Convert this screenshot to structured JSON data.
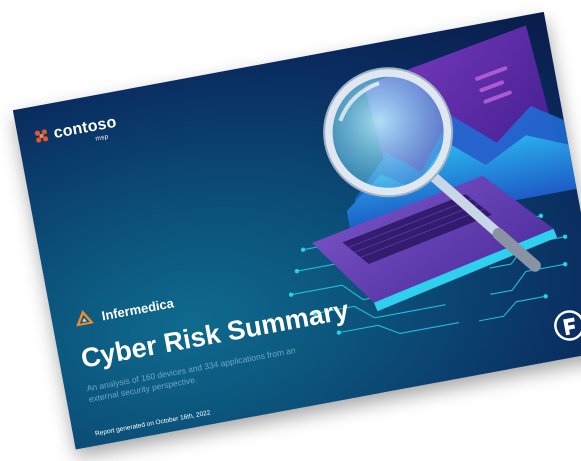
{
  "brand": {
    "name": "contoso",
    "sub": "msp"
  },
  "client": {
    "name": "Infermedica"
  },
  "report": {
    "title": "Cyber Risk Summary",
    "subtitle": "An analysis of 160 devices and 334 applications from an external security perspective.",
    "generated": "Report generated on October 16th, 2022"
  },
  "colors": {
    "brand_accent": "#e4572e",
    "client_accent": "#f28c28",
    "background": "#0b4f78",
    "art_purple": "#5b2ea6",
    "art_cyan": "#39d0f0"
  },
  "icons": {
    "brand_mark": "contoso-mark-icon",
    "client_logo": "infermedica-logo-icon",
    "corner_logo": "shield-logo-icon",
    "hero": "magnifying-glass-laptop-illustration"
  }
}
